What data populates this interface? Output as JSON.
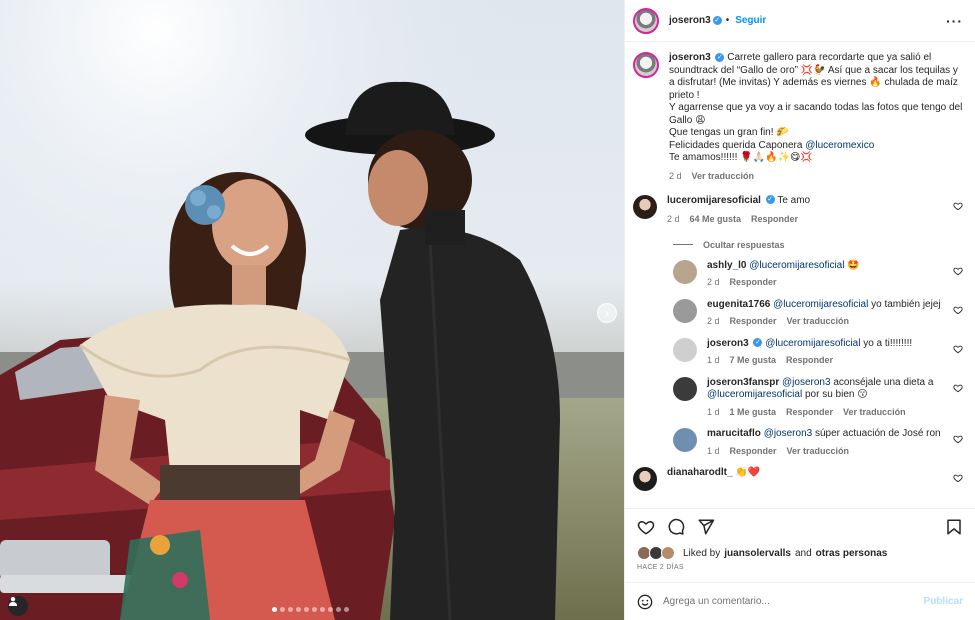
{
  "post": {
    "username": "joseron3",
    "follow_label": "Seguir",
    "more_icon": "more-horizontal-icon"
  },
  "caption": {
    "username": "joseron3",
    "lines": [
      "Carrete gallero para recordarte que ya salió el soundtrack del “Gallo de oro” 💢🐓 Así que a sacar los tequilas y a disfrutar! (Me invitas) Y además es viernes 🔥 chulada de maíz prieto !",
      "Y agarrense que ya voy a ir sacando todas las fotos que tengo del Gallo 😩",
      "Que tengas un gran fin! 🌮",
      "Felicidades querida Caponera",
      "Te amamos!!!!!! 🌹🙏🏻🔥✨😋💢"
    ],
    "mention": "@luceromexico",
    "time": "2 d",
    "translate": "Ver traducción"
  },
  "comments": [
    {
      "username": "luceromijaresoficial",
      "verified": true,
      "text": "Te amo",
      "time": "2 d",
      "likes": "64 Me gusta",
      "reply": "Responder"
    }
  ],
  "hidden_replies_label": "Ocultar respuestas",
  "replies": [
    {
      "username": "ashly_l0",
      "mention": "@luceromijaresoficial",
      "text": "🤩",
      "time": "2 d",
      "reply": "Responder",
      "avatar": "#b9a48d"
    },
    {
      "username": "eugenita1766",
      "mention": "@luceromijaresoficial",
      "text": "yo también jejej",
      "time": "2 d",
      "reply": "Responder",
      "translate": "Ver traducción",
      "avatar": "#9a9a9a"
    },
    {
      "username": "joseron3",
      "verified": true,
      "mention": "@luceromijaresoficial",
      "text": "yo a ti!!!!!!!!",
      "time": "1 d",
      "likes": "7 Me gusta",
      "reply": "Responder",
      "avatar": "#cfcfcf"
    },
    {
      "username": "joseron3fanspr",
      "mention": "@joseron3",
      "text": "aconséjale una dieta a",
      "mention2": "@luceromijaresoficial",
      "text2": "por su bien 😗",
      "time": "1 d",
      "likes": "1 Me gusta",
      "reply": "Responder",
      "translate": "Ver traducción",
      "avatar": "#3b3b3b"
    },
    {
      "username": "marucitaflo",
      "mention": "@joseron3",
      "text": "súper actuación de José ron",
      "time": "1 d",
      "reply": "Responder",
      "translate": "Ver traducción",
      "avatar": "#6f8fb0"
    }
  ],
  "last_comment": {
    "username": "dianaharodlt_",
    "text": "👏❤️"
  },
  "likes": {
    "prefix": "Liked by",
    "user": "juansolervalls",
    "suffix": "and",
    "others": "otras personas"
  },
  "posted_ago": "HACE 2 DÍAS",
  "composer": {
    "placeholder": "Agrega un comentario...",
    "publish_label": "Publicar"
  },
  "carousel": {
    "total": 10,
    "active_index": 0
  },
  "colors": {
    "accent": "#0095f6",
    "verified": "#3897f0",
    "link": "#00376b"
  }
}
